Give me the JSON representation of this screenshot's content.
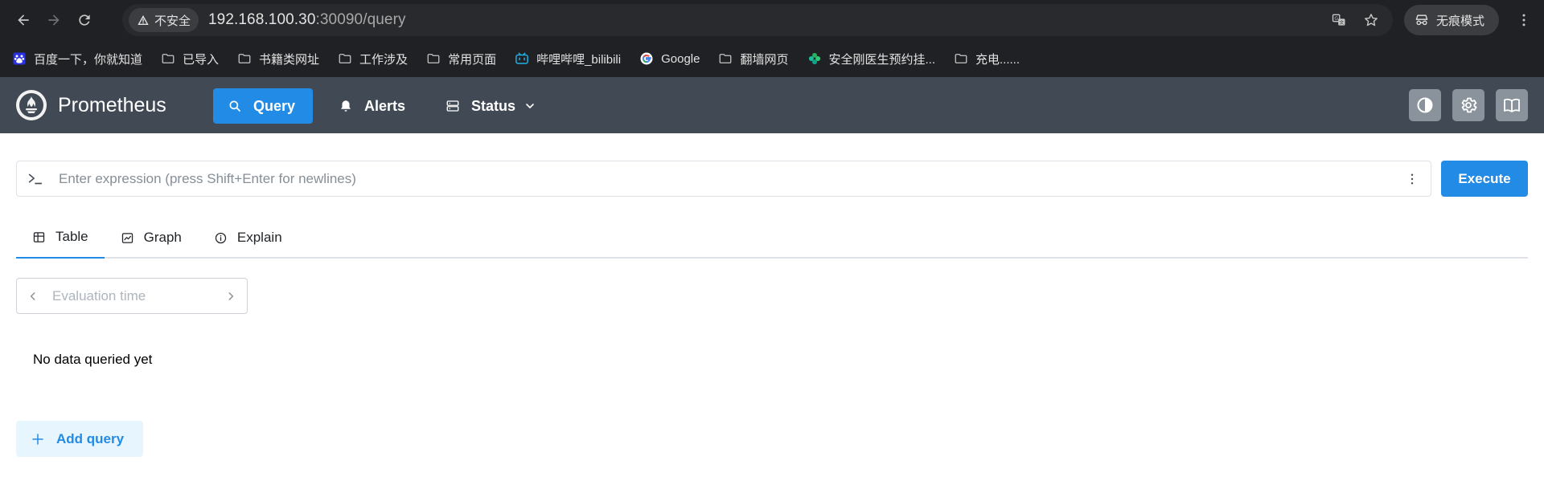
{
  "browser": {
    "security_label": "不安全",
    "url_host": "192.168.100.30",
    "url_path": ":30090/query",
    "incognito_label": "无痕模式",
    "bookmarks": [
      {
        "label": "百度一下，你就知道",
        "icon": "baidu-icon"
      },
      {
        "label": "已导入",
        "icon": "folder-icon"
      },
      {
        "label": "书籍类网址",
        "icon": "folder-icon"
      },
      {
        "label": "工作涉及",
        "icon": "folder-icon"
      },
      {
        "label": "常用页面",
        "icon": "folder-icon"
      },
      {
        "label": "哔哩哔哩_bilibili",
        "icon": "bilibili-icon"
      },
      {
        "label": "Google",
        "icon": "google-icon"
      },
      {
        "label": "翻墙网页",
        "icon": "folder-icon"
      },
      {
        "label": "安全刚医生预约挂...",
        "icon": "clover-icon"
      },
      {
        "label": "充电......",
        "icon": "folder-icon"
      }
    ]
  },
  "app": {
    "brand": "Prometheus",
    "nav": {
      "query": "Query",
      "alerts": "Alerts",
      "status": "Status"
    },
    "colors": {
      "header_bg": "#414a54",
      "accent": "#228be6"
    }
  },
  "query": {
    "placeholder": "Enter expression (press Shift+Enter for newlines)",
    "execute_label": "Execute",
    "tabs": {
      "table": "Table",
      "graph": "Graph",
      "explain": "Explain"
    },
    "eval_time_placeholder": "Evaluation time",
    "no_data": "No data queried yet",
    "add_query_label": "Add query"
  }
}
